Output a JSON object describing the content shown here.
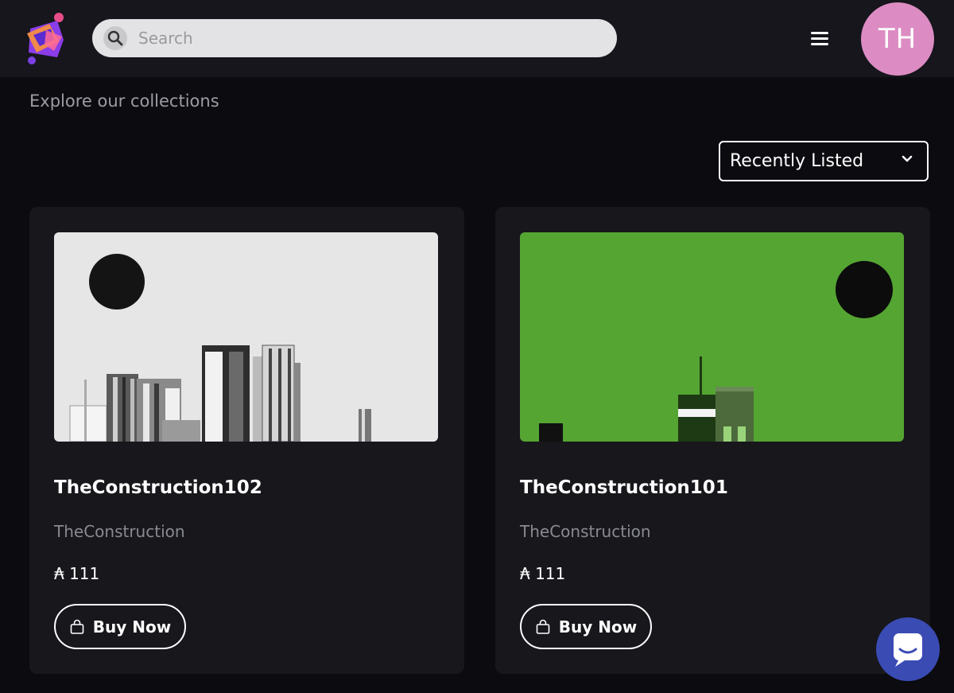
{
  "header": {
    "logo": "app-logo",
    "search": {
      "placeholder": "Search",
      "icon": "search-icon"
    },
    "menu_icon": "hamburger-menu-icon",
    "avatar_initials": "TH",
    "avatar_color": "#dc8cc3"
  },
  "page": {
    "subtitle": "Explore our collections",
    "sort": {
      "selected": "Recently Listed",
      "icon": "chevron-down-icon"
    }
  },
  "cards": [
    {
      "title": "TheConstruction102",
      "collection": "TheConstruction",
      "price": "₳ 111",
      "buy_label": "Buy Now",
      "image_bg": "#e6e6e6"
    },
    {
      "title": "TheConstruction101",
      "collection": "TheConstruction",
      "price": "₳ 111",
      "buy_label": "Buy Now",
      "image_bg": "#55a532"
    }
  ],
  "chat": {
    "icon": "chat-icon",
    "color": "#3b4bb4"
  }
}
